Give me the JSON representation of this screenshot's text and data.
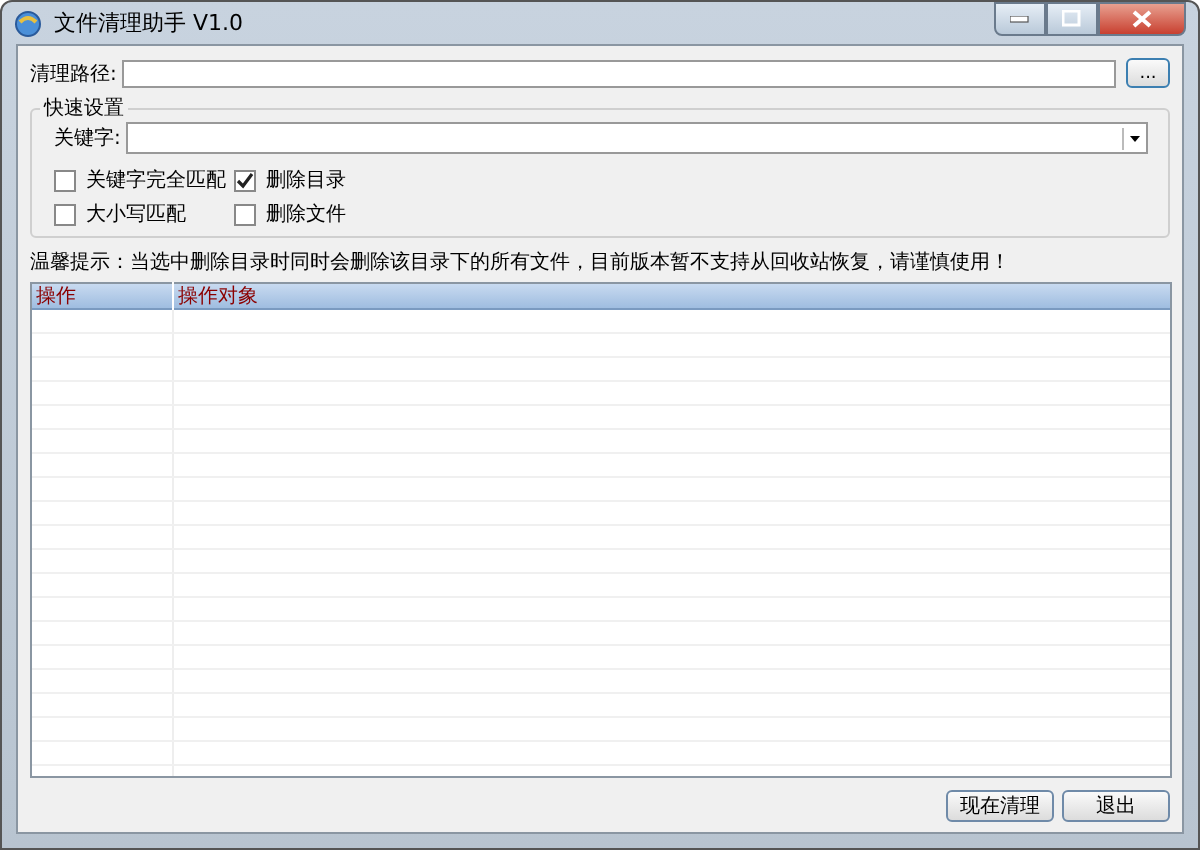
{
  "window": {
    "title": "文件清理助手 V1.0"
  },
  "path": {
    "label": "清理路径:",
    "browse": "..."
  },
  "quick_settings": {
    "title": "快速设置",
    "keyword_label": "关键字:",
    "options": [
      {
        "label": "关键字完全匹配",
        "checked": false
      },
      {
        "label": "删除目录",
        "checked": true
      },
      {
        "label": "大小写匹配",
        "checked": false
      },
      {
        "label": "删除文件",
        "checked": false
      }
    ]
  },
  "warning": "温馨提示：当选中删除目录时同时会删除该目录下的所有文件，目前版本暂不支持从回收站恢复，请谨慎使用！",
  "table": {
    "columns": [
      "操作",
      "操作对象"
    ]
  },
  "buttons": [
    "现在清理",
    "退出"
  ]
}
